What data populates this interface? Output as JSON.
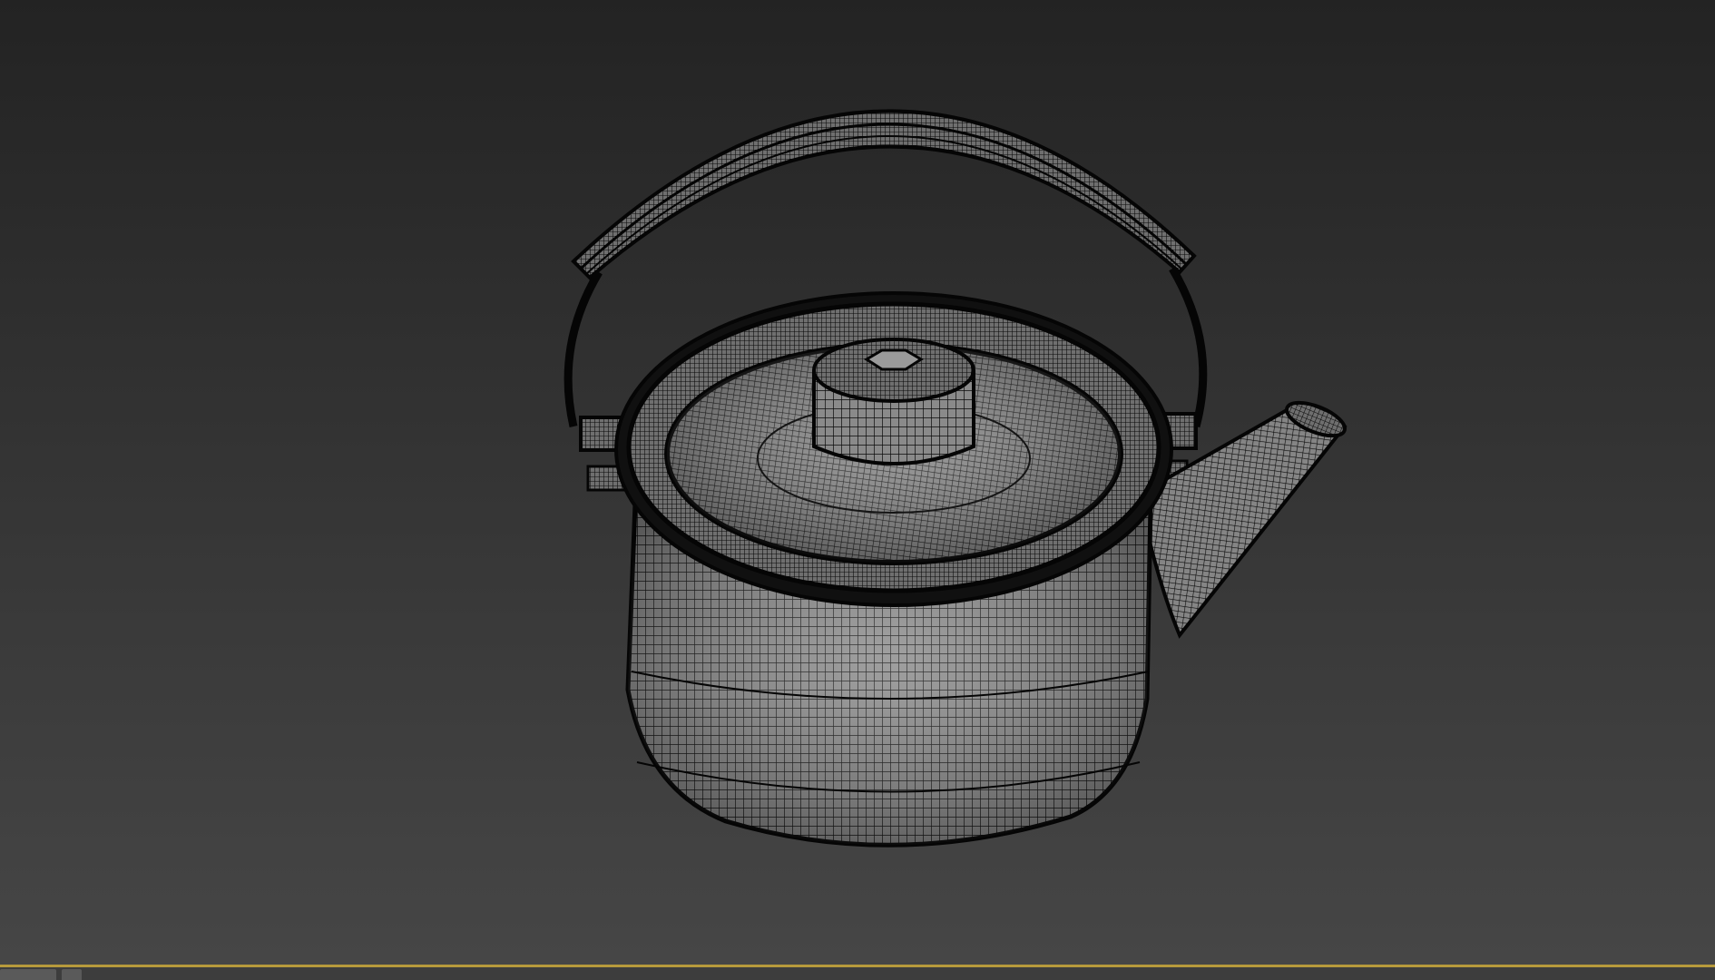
{
  "app": {
    "viewport_mode": "wireframe",
    "accent_color": "#b79a3c",
    "mesh_line_color": "#050505",
    "mesh_fill_color": "#7a7a7a"
  },
  "viewport": {
    "object": "teapot-kettle",
    "icons": {
      "handle": "kettle-handle-icon",
      "lid": "kettle-lid-icon",
      "spout": "kettle-spout-icon"
    }
  }
}
